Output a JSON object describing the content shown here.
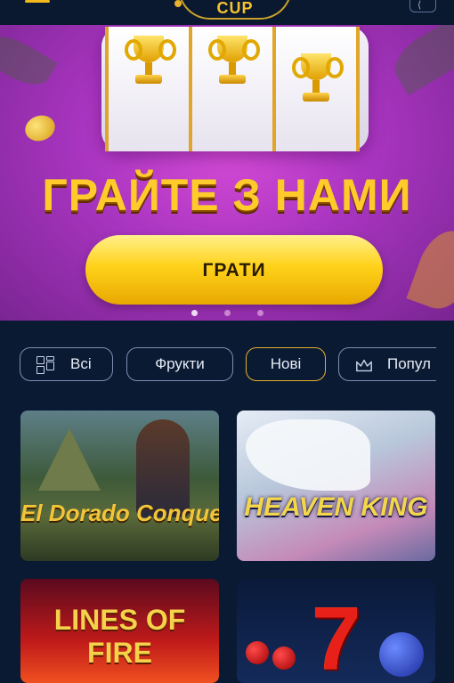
{
  "header": {
    "logo_text": "CUP",
    "menu_icon": "hamburger-icon",
    "login_icon": "login-icon"
  },
  "banner": {
    "title": "ГРАЙТЕ З НАМИ",
    "play_button": "ГРАТИ",
    "slides": 3,
    "active_slide": 1
  },
  "filters": [
    {
      "label": "Всі",
      "icon": "grid-icon",
      "active": false
    },
    {
      "label": "Фрукти",
      "icon": "",
      "active": false
    },
    {
      "label": "Нові",
      "icon": "",
      "active": true
    },
    {
      "label": "Попул",
      "icon": "crown-icon",
      "active": false
    }
  ],
  "games": [
    {
      "title": "El Dorado Conquest"
    },
    {
      "title": "Heaven King"
    },
    {
      "title": "Lines of Fire"
    },
    {
      "title": "7"
    }
  ],
  "colors": {
    "background": "#0b1a33",
    "accent": "#f2b81d",
    "banner": "#a935c0"
  }
}
